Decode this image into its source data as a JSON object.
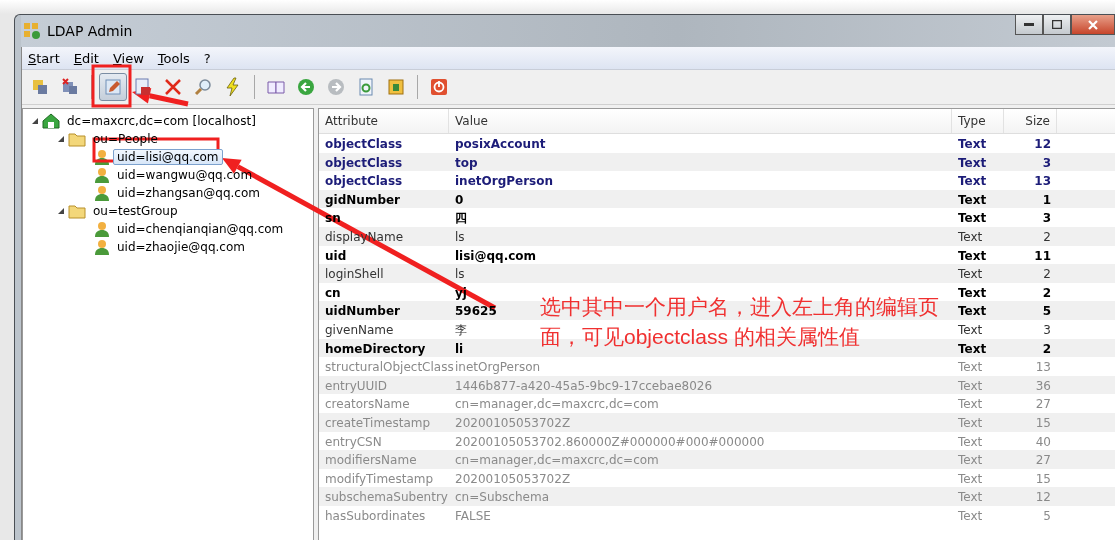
{
  "window": {
    "title": "LDAP Admin"
  },
  "menu": [
    "Start",
    "Edit",
    "View",
    "Tools",
    "?"
  ],
  "toolbar": [
    {
      "kind": "connect",
      "pressed": false
    },
    {
      "kind": "disconnect",
      "pressed": false
    },
    {
      "kind": "separator"
    },
    {
      "kind": "edit",
      "pressed": true
    },
    {
      "kind": "save",
      "pressed": false
    },
    {
      "kind": "delete",
      "pressed": false
    },
    {
      "kind": "search",
      "pressed": false
    },
    {
      "kind": "lightning",
      "pressed": false
    },
    {
      "kind": "separator"
    },
    {
      "kind": "book",
      "pressed": false
    },
    {
      "kind": "back",
      "pressed": false
    },
    {
      "kind": "forward",
      "pressed": false
    },
    {
      "kind": "refresh",
      "pressed": false
    },
    {
      "kind": "export",
      "pressed": false
    },
    {
      "kind": "separator"
    },
    {
      "kind": "power",
      "pressed": false
    }
  ],
  "tree": [
    {
      "label": "dc=maxcrc,dc=com [localhost]",
      "kind": "server",
      "selected": false,
      "expanded": true,
      "children": [
        {
          "label": "ou=People",
          "kind": "folder",
          "selected": false,
          "expanded": true,
          "children": [
            {
              "label": "uid=lisi@qq.com",
              "kind": "user",
              "selected": true
            },
            {
              "label": "uid=wangwu@qq.com",
              "kind": "user",
              "selected": false
            },
            {
              "label": "uid=zhangsan@qq.com",
              "kind": "user",
              "selected": false
            }
          ]
        },
        {
          "label": "ou=testGroup",
          "kind": "folder",
          "selected": false,
          "expanded": true,
          "children": [
            {
              "label": "uid=chenqianqian@qq.com",
              "kind": "user",
              "selected": false
            },
            {
              "label": "uid=zhaojie@qq.com",
              "kind": "user",
              "selected": false
            }
          ]
        }
      ]
    }
  ],
  "table": {
    "columns": [
      "Attribute",
      "Value",
      "Type",
      "Size"
    ],
    "rows": [
      {
        "kind": "objectclass",
        "attribute": "objectClass",
        "value": "posixAccount",
        "type": "Text",
        "size": "12"
      },
      {
        "kind": "objectclass",
        "attribute": "objectClass",
        "value": "top",
        "type": "Text",
        "size": "3"
      },
      {
        "kind": "objectclass",
        "attribute": "objectClass",
        "value": "inetOrgPerson",
        "type": "Text",
        "size": "13"
      },
      {
        "kind": "required",
        "attribute": "gidNumber",
        "value": "0",
        "type": "Text",
        "size": "1"
      },
      {
        "kind": "required",
        "attribute": "sn",
        "value": "四",
        "type": "Text",
        "size": "3"
      },
      {
        "kind": "optional",
        "attribute": "displayName",
        "value": "ls",
        "type": "Text",
        "size": "2"
      },
      {
        "kind": "required",
        "attribute": "uid",
        "value": "lisi@qq.com",
        "type": "Text",
        "size": "11"
      },
      {
        "kind": "optional",
        "attribute": "loginShell",
        "value": "ls",
        "type": "Text",
        "size": "2"
      },
      {
        "kind": "required",
        "attribute": "cn",
        "value": "yj",
        "type": "Text",
        "size": "2"
      },
      {
        "kind": "required",
        "attribute": "uidNumber",
        "value": "59625",
        "type": "Text",
        "size": "5"
      },
      {
        "kind": "optional",
        "attribute": "givenName",
        "value": "李",
        "type": "Text",
        "size": "3"
      },
      {
        "kind": "required",
        "attribute": "homeDirectory",
        "value": "li",
        "type": "Text",
        "size": "2"
      },
      {
        "kind": "operational",
        "attribute": "structuralObjectClass",
        "value": "inetOrgPerson",
        "type": "Text",
        "size": "13"
      },
      {
        "kind": "operational",
        "attribute": "entryUUID",
        "value": "1446b877-a420-45a5-9bc9-17ccebae8026",
        "type": "Text",
        "size": "36"
      },
      {
        "kind": "operational",
        "attribute": "creatorsName",
        "value": "cn=manager,dc=maxcrc,dc=com",
        "type": "Text",
        "size": "27"
      },
      {
        "kind": "operational",
        "attribute": "createTimestamp",
        "value": "20200105053702Z",
        "type": "Text",
        "size": "15"
      },
      {
        "kind": "operational",
        "attribute": "entryCSN",
        "value": "20200105053702.860000Z#000000#000#000000",
        "type": "Text",
        "size": "40"
      },
      {
        "kind": "operational",
        "attribute": "modifiersName",
        "value": "cn=manager,dc=maxcrc,dc=com",
        "type": "Text",
        "size": "27"
      },
      {
        "kind": "operational",
        "attribute": "modifyTimestamp",
        "value": "20200105053702Z",
        "type": "Text",
        "size": "15"
      },
      {
        "kind": "operational",
        "attribute": "subschemaSubentry",
        "value": "cn=Subschema",
        "type": "Text",
        "size": "12"
      },
      {
        "kind": "operational",
        "attribute": "hasSubordinates",
        "value": "FALSE",
        "type": "Text",
        "size": "5"
      }
    ]
  },
  "annotation": {
    "text": "选中其中一个用户名，进入左上角的编辑页面，可见objectclass 的相关属性值"
  }
}
